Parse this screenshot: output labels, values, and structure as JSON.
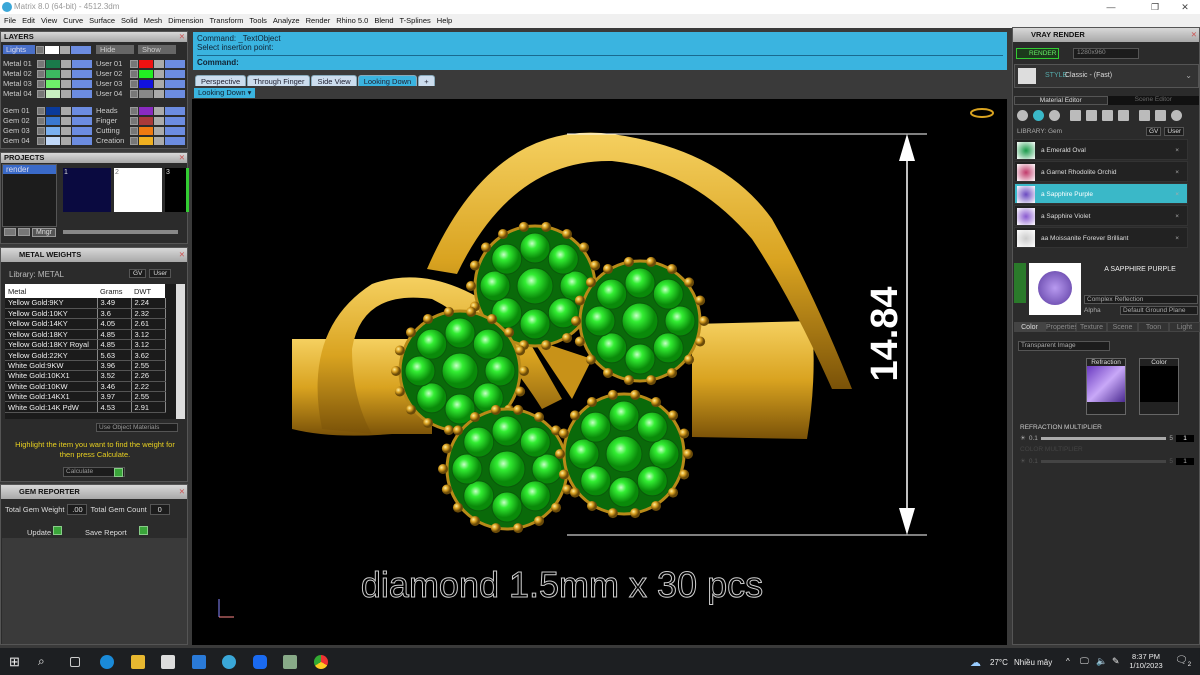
{
  "window": {
    "title": "Matrix 8.0 (64-bit) - 4512.3dm",
    "controls": [
      "—",
      "❐",
      "✕"
    ]
  },
  "menu": [
    "File",
    "Edit",
    "View",
    "Curve",
    "Surface",
    "Solid",
    "Mesh",
    "Dimension",
    "Transform",
    "Tools",
    "Analyze",
    "Render",
    "Rhino 5.0",
    "Blend",
    "T-Splines",
    "Help"
  ],
  "layers": {
    "title": "LAYERS",
    "lights": "Lights",
    "hide": "Hide",
    "show": "Show",
    "left": [
      {
        "name": "Metal 01",
        "color": "#1a7a4a"
      },
      {
        "name": "Metal 02",
        "color": "#3cb860"
      },
      {
        "name": "Metal 03",
        "color": "#6ef06a"
      },
      {
        "name": "Metal 04",
        "color": "#c8f0c0"
      },
      {
        "name": "Gem 01",
        "color": "#0a3a9a"
      },
      {
        "name": "Gem 02",
        "color": "#3a78d0"
      },
      {
        "name": "Gem 03",
        "color": "#7ab0f0"
      },
      {
        "name": "Gem 04",
        "color": "#c0d8f8"
      }
    ],
    "right": [
      {
        "name": "User 01",
        "color": "#ee1111"
      },
      {
        "name": "User 02",
        "color": "#22ee22"
      },
      {
        "name": "User 03",
        "color": "#1111dd"
      },
      {
        "name": "User 04",
        "color": "#888888"
      },
      {
        "name": "Heads",
        "color": "#8a2ac0"
      },
      {
        "name": "Finger",
        "color": "#aa3a3a"
      },
      {
        "name": "Cutting",
        "color": "#ee7a11"
      },
      {
        "name": "Creation",
        "color": "#f0b020"
      }
    ]
  },
  "projects": {
    "title": "PROJECTS",
    "items": [
      "render"
    ],
    "thumbs": [
      "1",
      "2",
      "3"
    ],
    "mgr": "Mngr"
  },
  "metal_weights": {
    "title": "METAL WEIGHTS",
    "library": "Library: METAL",
    "gv": "GV",
    "user": "User",
    "columns": [
      "Metal",
      "Grams",
      "DWT"
    ],
    "rows": [
      [
        "Yellow Gold:9KY",
        "3.49",
        "2.24"
      ],
      [
        "Yellow Gold:10KY",
        "3.6",
        "2.32"
      ],
      [
        "Yellow Gold:14KY",
        "4.05",
        "2.61"
      ],
      [
        "Yellow Gold:18KY",
        "4.85",
        "3.12"
      ],
      [
        "Yellow Gold:18KY Royal",
        "4.85",
        "3.12"
      ],
      [
        "Yellow Gold:22KY",
        "5.63",
        "3.62"
      ],
      [
        "White Gold:9KW",
        "3.96",
        "2.55"
      ],
      [
        "White Gold:10KX1",
        "3.52",
        "2.26"
      ],
      [
        "White Gold:10KW",
        "3.46",
        "2.22"
      ],
      [
        "White Gold:14KX1",
        "3.97",
        "2.55"
      ],
      [
        "White Gold:14K PdW",
        "4.53",
        "2.91"
      ]
    ],
    "use_object": "Use Object Materials",
    "hint": "Highlight the item you want to find the weight for then press Calculate.",
    "calculate": "Calculate"
  },
  "gem_reporter": {
    "title": "GEM REPORTER",
    "weight_label": "Total Gem Weight",
    "weight": ".00",
    "count_label": "Total Gem Count",
    "count": "0",
    "update": "Update",
    "save": "Save Report"
  },
  "command": {
    "line1": "Command: _TextObject",
    "line2": "Select insertion point:",
    "prompt": "Command:"
  },
  "tabs": [
    "Perspective",
    "Through Finger",
    "Side View",
    "Looking Down"
  ],
  "active_tab": "Looking Down",
  "viewport_label": "Looking Down",
  "viewport": {
    "dimension": "14.84",
    "annotation": "diamond 1.5mm x 30 pcs",
    "gold": "#d9a320",
    "gem": "#22dd22"
  },
  "vray": {
    "title": "VRAY RENDER",
    "render": "RENDER",
    "resolution": "1280x960",
    "style_label": "STYLE",
    "style": "Classic - (Fast)",
    "tabs": [
      "Material Editor",
      "Scene Editor"
    ],
    "library": "LIBRARY: Gem",
    "gv": "GV",
    "user": "User",
    "materials": [
      {
        "name": "a Emerald Oval",
        "color": "#1a9a4a"
      },
      {
        "name": "a Garnet Rhodolite Orchid",
        "color": "#c03a6a"
      },
      {
        "name": "a Sapphire Purple",
        "color": "#6a4ac0",
        "selected": true
      },
      {
        "name": "a Sapphire Violet",
        "color": "#8a5ad0"
      },
      {
        "name": "aa Moissanite Forever Brilliant",
        "color": "#ccc"
      }
    ],
    "selected_name": "A SAPPHIRE PURPLE",
    "reflection": "Complex Reflection",
    "alpha": "Alpha",
    "ground": "Default Ground Plane",
    "subtabs": [
      "Color",
      "Properties",
      "Texture",
      "Scene",
      "Toon",
      "Light"
    ],
    "image_mode": "Transparent Image",
    "refraction": "Refraction",
    "color": "Color",
    "refr_mult": {
      "label": "REFRACTION MULTIPLIER",
      "min": "0.1",
      "max": "5",
      "value": "1"
    },
    "color_mult": {
      "label": "COLOR MULTIPLIER",
      "min": "0.1",
      "max": "5",
      "value": "1"
    }
  },
  "taskbar": {
    "weather_temp": "27°C",
    "weather_text": "Nhiều mây",
    "time": "8:37 PM",
    "date": "1/10/2023",
    "notifications": "2"
  }
}
